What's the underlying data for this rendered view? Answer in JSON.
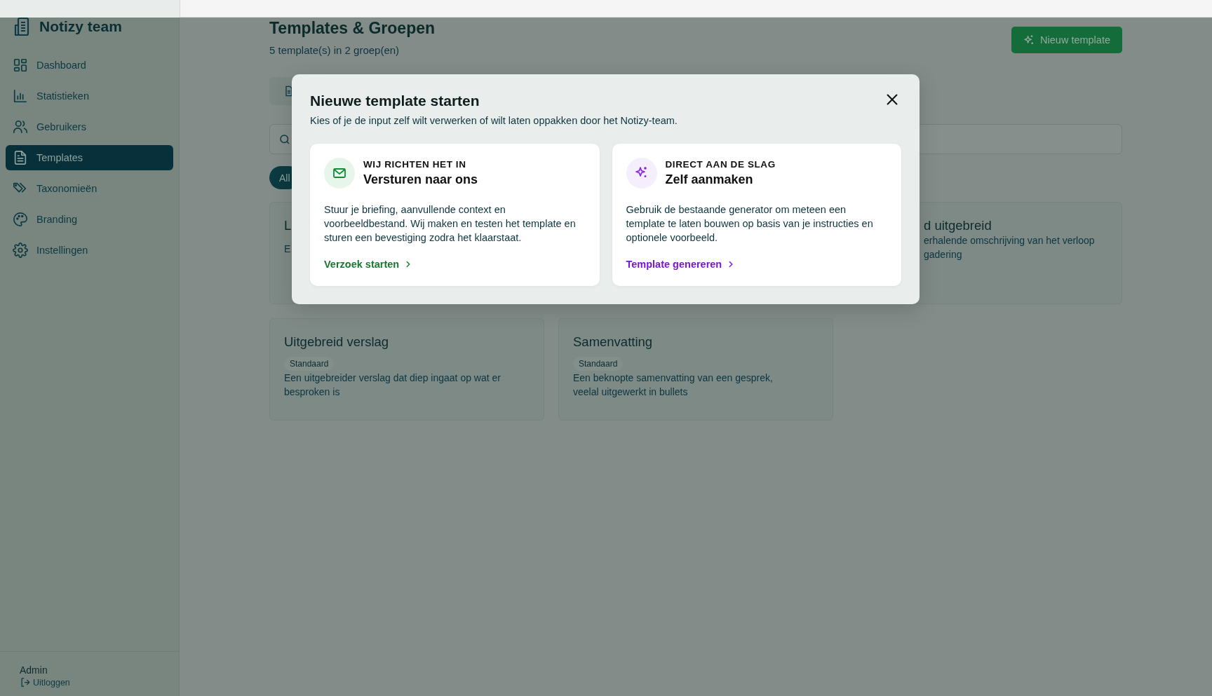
{
  "app": {
    "name": "Notizy team"
  },
  "sidebar": {
    "items": [
      {
        "label": "Dashboard",
        "selected": false
      },
      {
        "label": "Statistieken",
        "selected": false
      },
      {
        "label": "Gebruikers",
        "selected": false
      },
      {
        "label": "Templates",
        "selected": true
      },
      {
        "label": "Taxonomieën",
        "selected": false
      },
      {
        "label": "Branding",
        "selected": false
      },
      {
        "label": "Instellingen",
        "selected": false
      }
    ],
    "user": {
      "name": "Admin",
      "logout": "Uitloggen"
    }
  },
  "header": {
    "title": "Templates & Groepen",
    "subtitle": "5 template(s) in 2 groep(en)",
    "new_button": "Nieuw template"
  },
  "filter_chip": {
    "label": "All",
    "selected": true
  },
  "cards": [
    {
      "title": "L",
      "description_lines": [
        "E"
      ]
    },
    {
      "title": "d uitgebreid",
      "description_lines": [
        "erhalende omschrijving van het verloop",
        "gadering"
      ]
    },
    {
      "title": "Uitgebreid verslag",
      "badge": "Standaard",
      "description_lines": [
        "Een uitgebreider verslag dat diep ingaat op wat er",
        "besproken is"
      ]
    },
    {
      "title": "Samenvatting",
      "badge": "Standaard",
      "description_lines": [
        "Een beknopte samenvatting van een gesprek,",
        "veelal uitgewerkt in bullets"
      ]
    }
  ],
  "modal": {
    "title": "Nieuwe template starten",
    "subtitle": "Kies of je de input zelf wilt verwerken of wilt laten oppakken door het Notizy-team.",
    "options": [
      {
        "kind": "send",
        "eyebrow": "WIJ RICHTEN HET IN",
        "title": "Versturen naar ons",
        "text": "Stuur je briefing, aanvullende context en voorbeeldbestand. Wij maken en testen het template en sturen een bevestiging zodra het klaarstaat.",
        "link": "Verzoek starten"
      },
      {
        "kind": "generate",
        "eyebrow": "DIRECT AAN DE SLAG",
        "title": "Zelf aanmaken",
        "text": "Gebruik de bestaande generator om meteen een template te laten bouwen op basis van je instructies en optionele voorbeeld.",
        "link": "Template genereren"
      }
    ]
  }
}
